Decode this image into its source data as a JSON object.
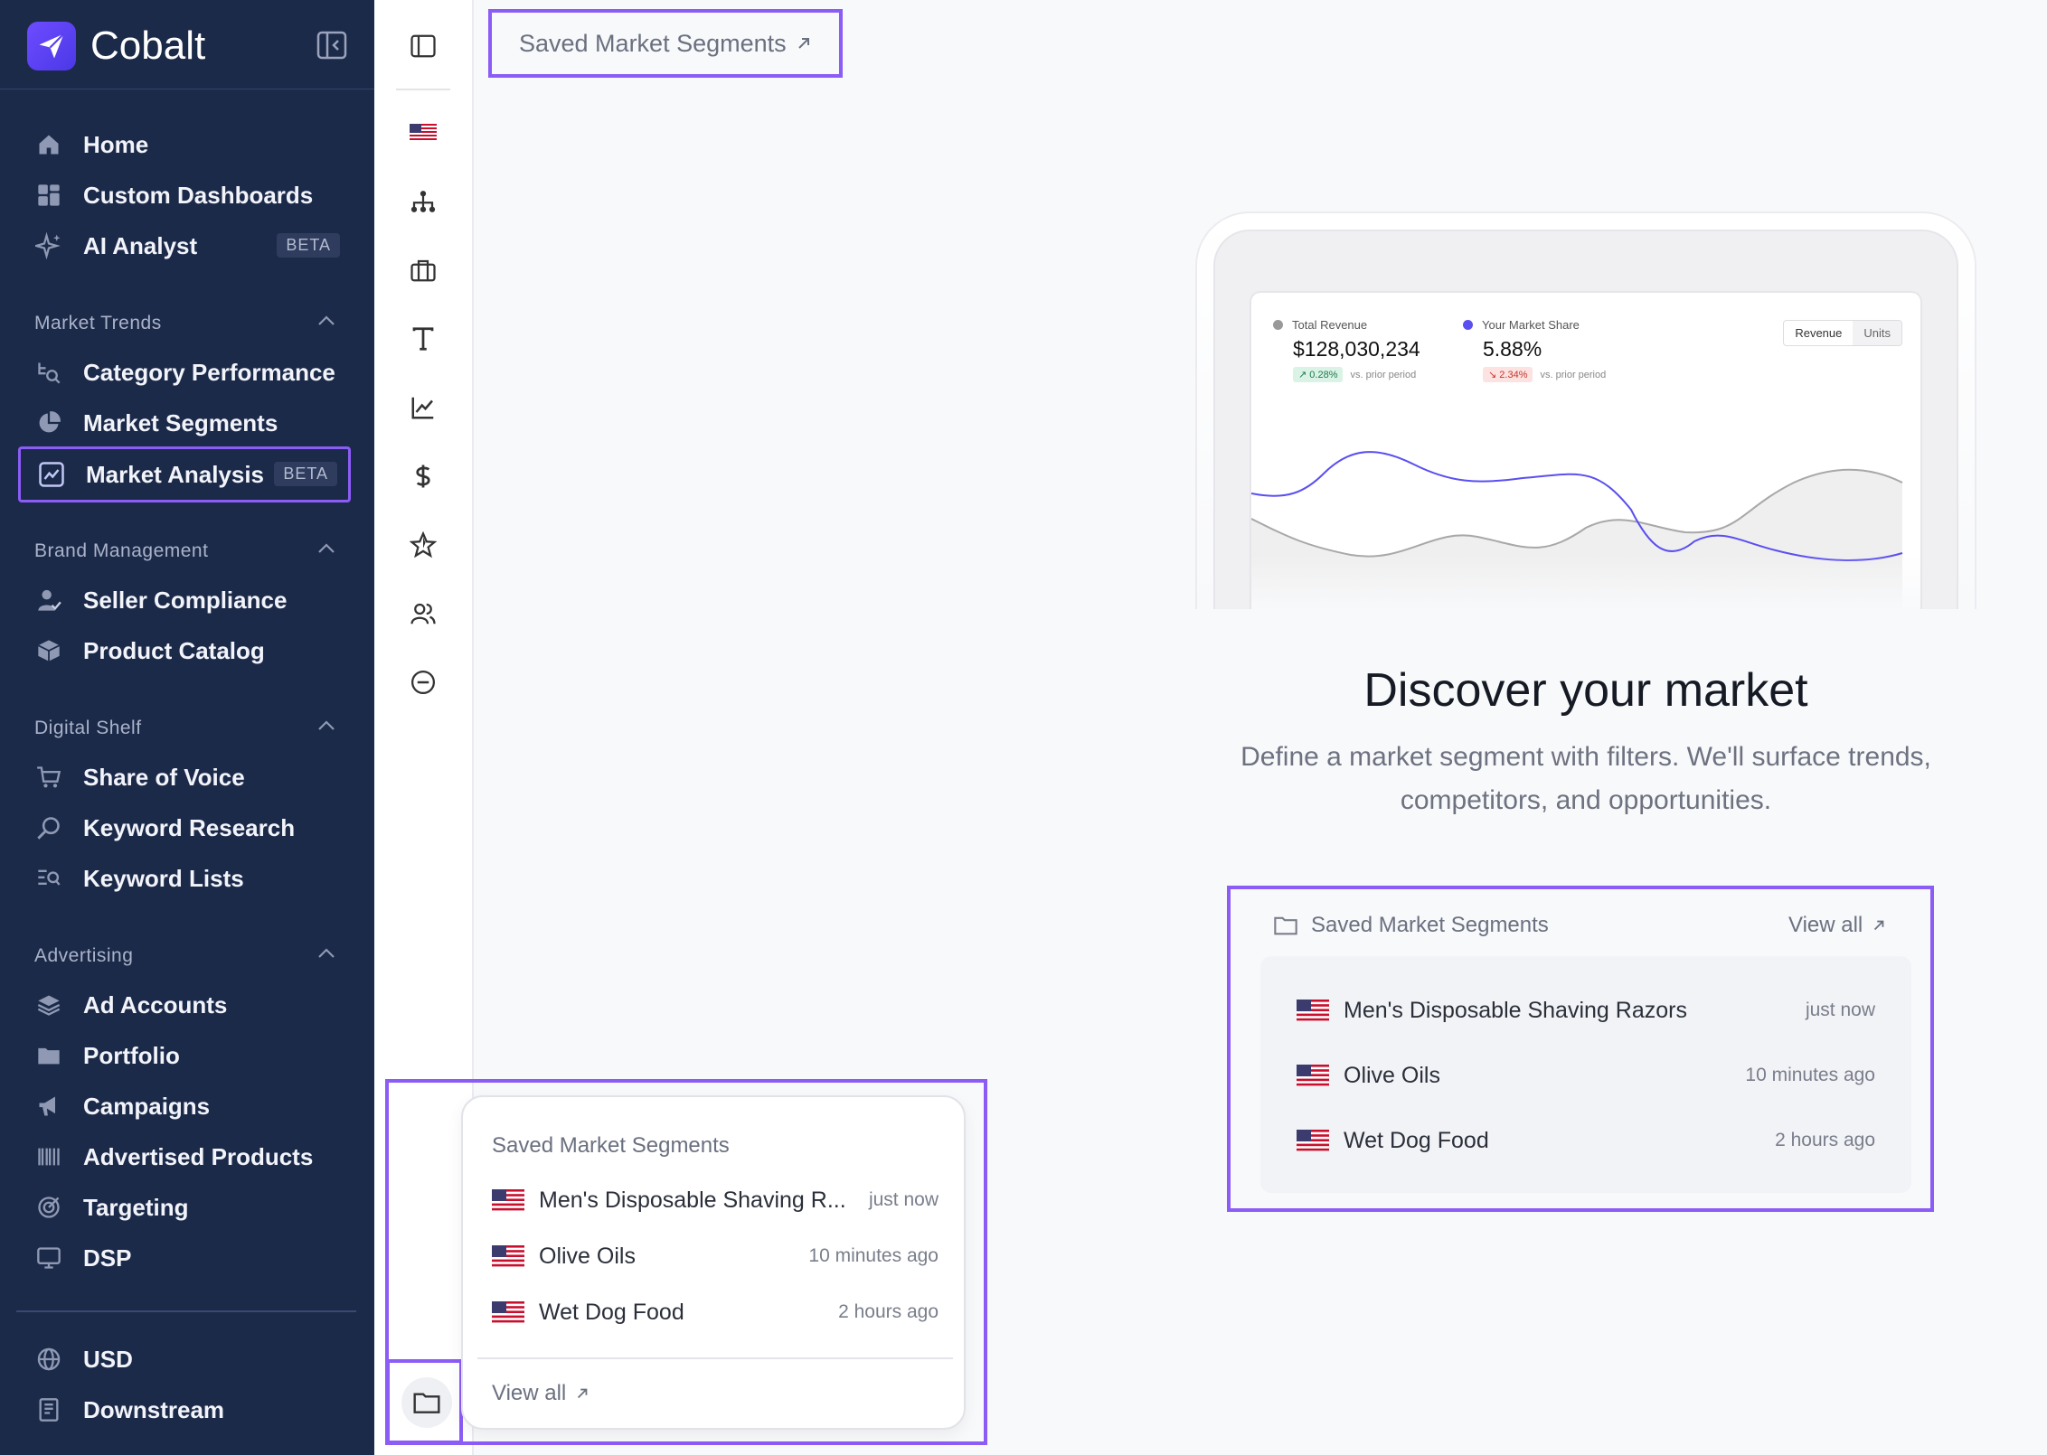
{
  "brand": {
    "name": "Cobalt",
    "accent": "#8b5cf6",
    "sidebar_bg": "#1c2a4a"
  },
  "nav": {
    "top": [
      {
        "label": "Home",
        "icon": "home-icon"
      },
      {
        "label": "Custom Dashboards",
        "icon": "dashboard-icon"
      },
      {
        "label": "AI Analyst",
        "icon": "sparkle-icon",
        "badge": "BETA"
      }
    ],
    "sections": [
      {
        "title": "Market Trends",
        "items": [
          {
            "label": "Category Performance",
            "icon": "category-search-icon"
          },
          {
            "label": "Market Segments",
            "icon": "pie-chart-icon"
          },
          {
            "label": "Market Analysis",
            "icon": "trend-chart-icon",
            "badge": "BETA",
            "active": true
          }
        ]
      },
      {
        "title": "Brand Management",
        "items": [
          {
            "label": "Seller Compliance",
            "icon": "user-check-icon"
          },
          {
            "label": "Product Catalog",
            "icon": "box-icon"
          }
        ]
      },
      {
        "title": "Digital Shelf",
        "items": [
          {
            "label": "Share of Voice",
            "icon": "cart-icon"
          },
          {
            "label": "Keyword Research",
            "icon": "magnifier-icon"
          },
          {
            "label": "Keyword Lists",
            "icon": "list-search-icon"
          }
        ]
      },
      {
        "title": "Advertising",
        "items": [
          {
            "label": "Ad Accounts",
            "icon": "layers-icon"
          },
          {
            "label": "Portfolio",
            "icon": "folder-icon"
          },
          {
            "label": "Campaigns",
            "icon": "megaphone-icon"
          },
          {
            "label": "Advertised Products",
            "icon": "barcode-icon"
          },
          {
            "label": "Targeting",
            "icon": "target-icon"
          },
          {
            "label": "DSP",
            "icon": "monitor-icon"
          }
        ]
      }
    ],
    "bottom": [
      {
        "label": "USD",
        "icon": "globe-icon"
      },
      {
        "label": "Downstream",
        "icon": "document-icon"
      }
    ]
  },
  "rail_icons": [
    "sidebar-toggle-icon",
    "us-flag-icon",
    "hierarchy-icon",
    "briefcase-icon",
    "text-icon",
    "line-chart-icon",
    "dollar-icon",
    "star-icon",
    "users-icon",
    "minus-circle-icon",
    "folder-icon"
  ],
  "top_link": {
    "label": "Saved Market Segments"
  },
  "preview": {
    "metric1": {
      "label": "Total Revenue",
      "value": "$128,030,234",
      "change": "0.28%",
      "note": "vs. prior period"
    },
    "metric2": {
      "label": "Your Market Share",
      "value": "5.88%",
      "change": "2.34%",
      "note": "vs. prior period"
    },
    "toggle": [
      "Revenue",
      "Units"
    ]
  },
  "hero": {
    "title": "Discover your market",
    "subtitle": "Define a market segment with filters. We'll surface trends, competitors, and opportunities."
  },
  "saved_card": {
    "title": "Saved Market Segments",
    "view_all": "View all",
    "rows": [
      {
        "name": "Men's Disposable Shaving Razors",
        "time": "just now"
      },
      {
        "name": "Olive Oils",
        "time": "10 minutes ago"
      },
      {
        "name": "Wet Dog Food",
        "time": "2 hours ago"
      }
    ]
  },
  "popover": {
    "title": "Saved Market Segments",
    "view_all": "View all",
    "rows": [
      {
        "name": "Men's Disposable Shaving R...",
        "time": "just now"
      },
      {
        "name": "Olive Oils",
        "time": "10 minutes ago"
      },
      {
        "name": "Wet Dog Food",
        "time": "2 hours ago"
      }
    ]
  }
}
